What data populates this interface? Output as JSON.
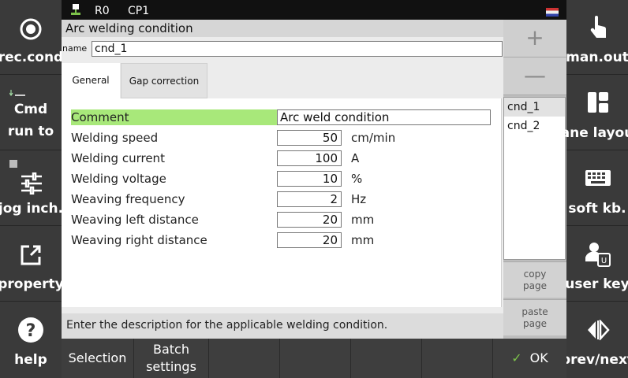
{
  "statusbar": {
    "robot": "R0",
    "program": "CP1"
  },
  "left_panel": [
    {
      "label": "rec.cond",
      "icon": "record-icon"
    },
    {
      "label": "Cmd",
      "label2": "run to",
      "icon": "step-icon"
    },
    {
      "label": "jog inch.",
      "icon": "sliders-icon"
    },
    {
      "label": "property",
      "icon": "open-external-icon"
    },
    {
      "label": "help",
      "icon": "help-icon"
    }
  ],
  "right_panel": [
    {
      "label": "man.out",
      "icon": "hand-pointer-icon"
    },
    {
      "label": "ane layou",
      "icon": "pane-layout-icon"
    },
    {
      "label": "soft kb.",
      "icon": "keyboard-icon"
    },
    {
      "label": "user key",
      "icon": "user-key-icon"
    },
    {
      "label": "prev/next",
      "icon": "prev-next-icon"
    }
  ],
  "window": {
    "title": "Arc welding condition",
    "name_label": "name",
    "name_value": "cnd_1",
    "tabs": [
      "General",
      "Gap correction"
    ],
    "active_tab": "General",
    "fields": {
      "comment": {
        "label": "Comment",
        "value": "Arc weld condition"
      },
      "rows": [
        {
          "label": "Welding speed",
          "value": "50",
          "unit": "cm/min"
        },
        {
          "label": "Welding current",
          "value": "100",
          "unit": "A"
        },
        {
          "label": "Welding voltage",
          "value": "10",
          "unit": "%"
        },
        {
          "label": "Weaving frequency",
          "value": "2",
          "unit": "Hz"
        },
        {
          "label": "Weaving left distance",
          "value": "20",
          "unit": "mm"
        },
        {
          "label": "Weaving right distance",
          "value": "20",
          "unit": "mm"
        }
      ]
    },
    "hint": "Enter the description for the applicable welding condition."
  },
  "list": {
    "add": "+",
    "remove": "—",
    "items": [
      "cnd_1",
      "cnd_2"
    ],
    "selected": "cnd_1",
    "copy_page": [
      "copy",
      "page"
    ],
    "paste_page": [
      "paste",
      "page"
    ]
  },
  "bottom_bar": {
    "selection": "Selection",
    "batch": [
      "Batch",
      "settings"
    ],
    "ok": "OK"
  },
  "colors": {
    "highlight": "#a8e87a",
    "ok_check": "#7cc24a"
  }
}
